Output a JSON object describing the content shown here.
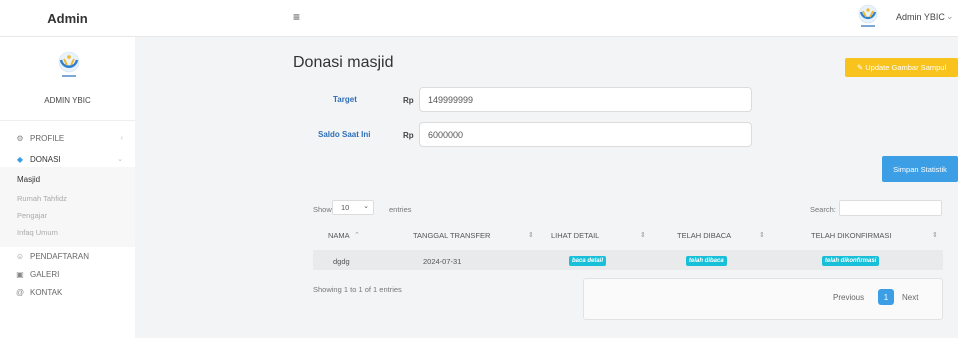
{
  "topbar": {
    "brand": "Admin",
    "menu_icon": "hamburger-icon",
    "user_name": "Admin YBIC",
    "user_chevron": "⌄"
  },
  "sidebar": {
    "admin_label": "ADMIN YBIC",
    "items": [
      {
        "label": "PROFILE",
        "icon": "gear-icon",
        "chevron": "‹"
      },
      {
        "label": "DONASI",
        "icon": "shield-icon",
        "chevron": "⌄"
      },
      {
        "label": "PENDAFTARAN",
        "icon": "users-icon"
      },
      {
        "label": "GALERI",
        "icon": "image-icon"
      },
      {
        "label": "KONTAK",
        "icon": "at-icon"
      }
    ],
    "sub_items": [
      "Masjid",
      "Rumah Tahfidz",
      "Pengajar",
      "Infaq Umum"
    ]
  },
  "main": {
    "title": "Donasi masjid",
    "update_button": "✎ Update Gambar Sampul",
    "target_label": "Target",
    "target_currency": "Rp",
    "target_value": "149999999",
    "saldo_label": "Saldo Saat Ini",
    "saldo_currency": "Rp",
    "saldo_value": "6000000",
    "save_button": "Simpan Statistik"
  },
  "table": {
    "show_label": "Show",
    "page_size": "10",
    "entries_label": "entries",
    "search_label": "Search:",
    "columns": [
      "NAMA",
      "TANGGAL TRANSFER",
      "LIHAT DETAIL",
      "TELAH DIBACA",
      "TELAH DIKONFIRMASI"
    ],
    "rows": [
      {
        "nama": "dgdg",
        "tanggal": "2024-07-31",
        "detail": "baca detail",
        "dibaca": "telah dibaca",
        "konfirmasi": "telah dikonfirmasi"
      }
    ],
    "info": "Showing 1 to 1 of 1 entries",
    "prev": "Previous",
    "page": "1",
    "next": "Next"
  },
  "colors": {
    "accent_yellow": "#f7c31c",
    "accent_blue": "#3c9ee5",
    "badge_cyan": "#17c0d8",
    "label_blue": "#2e6fb7"
  }
}
